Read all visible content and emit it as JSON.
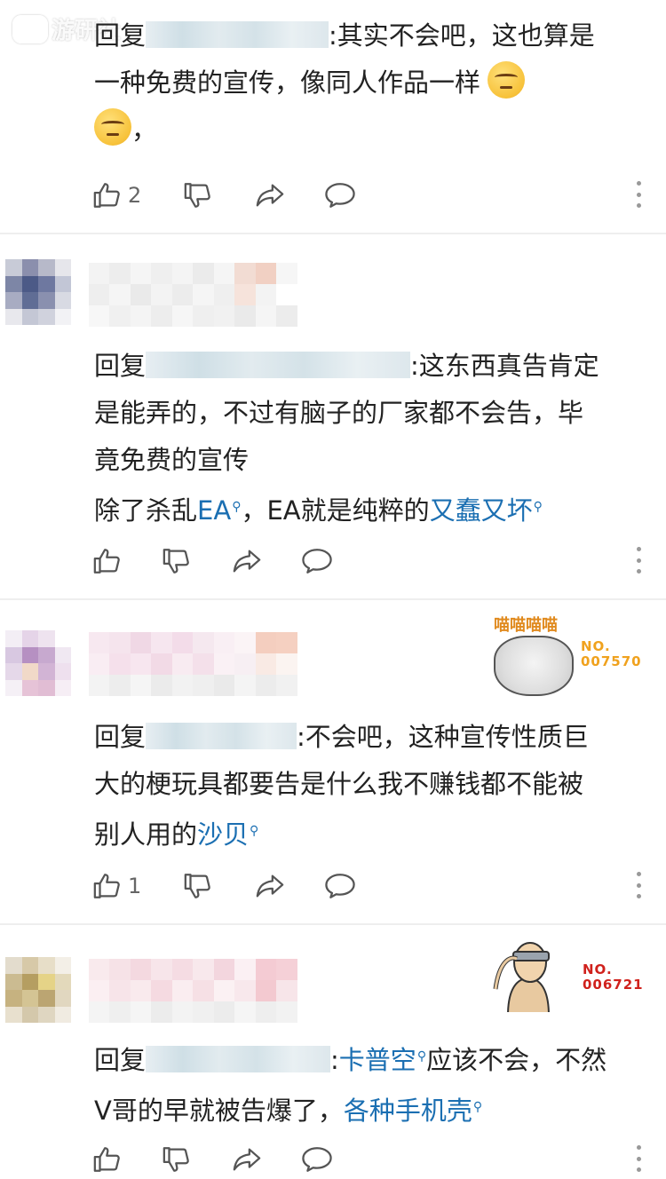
{
  "watermark": {
    "text": "游研社"
  },
  "comments": [
    {
      "reply_prefix": "回复",
      "lines": [
        ":其实不会吧，这也算是",
        "一种免费的宣传，像同人作品一样",
        "，"
      ],
      "likes": "2"
    },
    {
      "reply_prefix": "回复",
      "lines": [
        ":这东西真告肯定",
        "是能弄的，不过有脑子的厂家都不会告，毕",
        "竟免费的宣传"
      ],
      "line4_before": "除了杀乱",
      "link_ea": "EA",
      "line4_mid": "，EA就是纯粹的",
      "link_2": "又蠢又坏",
      "likes": ""
    },
    {
      "reply_prefix": "回复",
      "lines": [
        ":不会吧，这种宣传性质巨",
        "大的梗玩具都要告是什么我不赚钱都不能被"
      ],
      "line3_before": "别人用的",
      "link_1": "沙贝",
      "likes": "1",
      "badge": {
        "miao": "喵喵喵喵",
        "no": "NO.",
        "num": "007570",
        "color": "#f0a21e"
      }
    },
    {
      "reply_prefix": "回复",
      "colon": ":",
      "link_1": "卡普空",
      "line1_after": "应该不会，不然",
      "line2_before": "V哥的早就被告爆了，",
      "link_2": "各种手机壳",
      "likes": "",
      "badge": {
        "no": "NO.",
        "num": "006721",
        "color": "#d0211c"
      }
    }
  ],
  "icons": {
    "like": "thumbs-up-icon",
    "dislike": "thumbs-down-icon",
    "share": "share-arrow-icon",
    "comment": "speech-bubble-icon",
    "more": "more-vertical-icon"
  },
  "colors": {
    "link": "#1b6fb2",
    "divider": "#eeeeee",
    "icon": "#555555"
  }
}
